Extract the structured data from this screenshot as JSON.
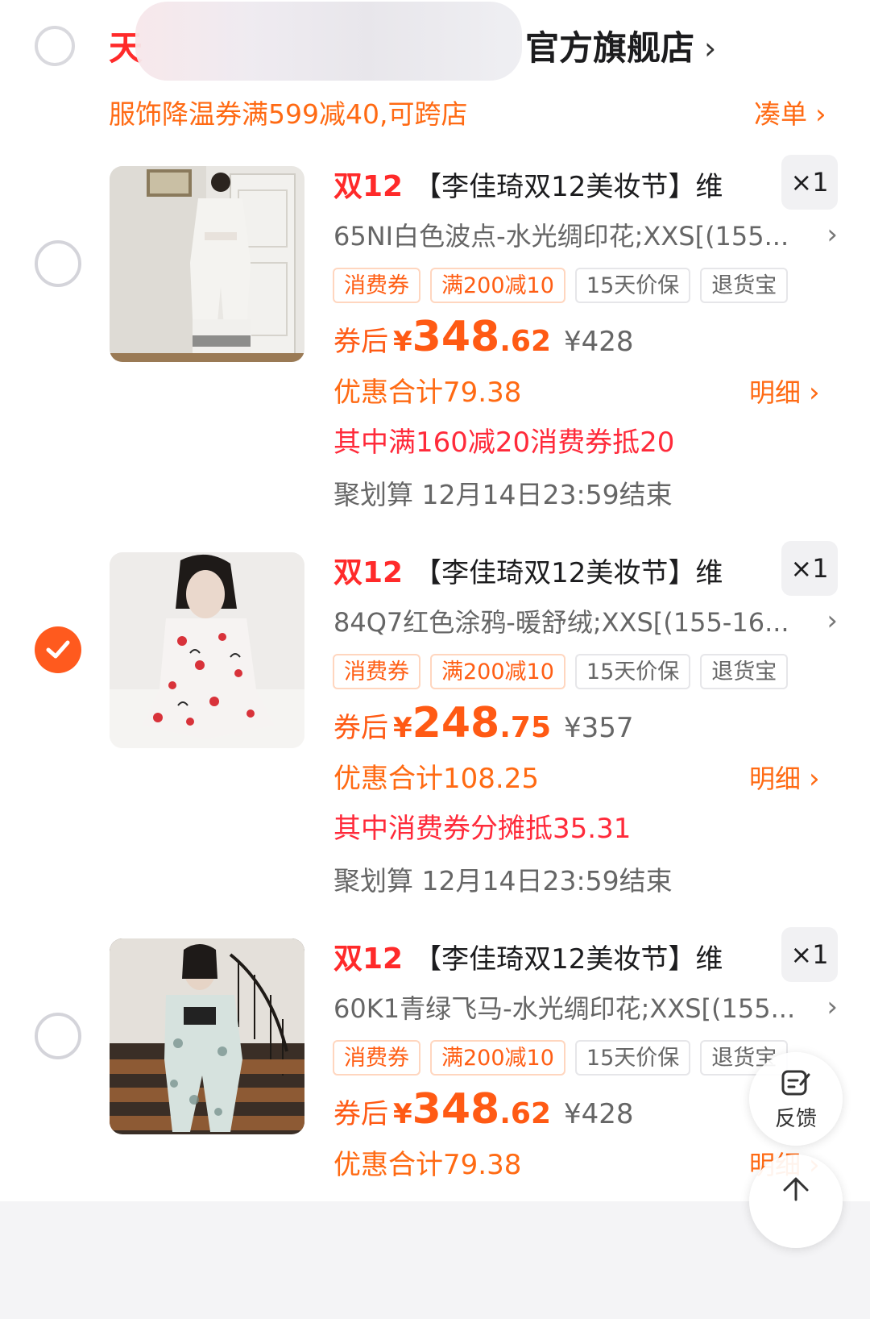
{
  "header": {
    "shop_name_prefix": "天",
    "shop_name_suffix": "官方旗舰店",
    "shop_chevron": "›",
    "promo_text": "服饰降温券满599减40,可跨店",
    "coudan_label": "凑单",
    "coudan_chevron": "›"
  },
  "items": [
    {
      "selected": false,
      "promo_tag": "双12",
      "title": "【李佳琦双12美妆节】维",
      "qty": "×1",
      "sku": "65NI白色波点-水光绸印花;XXS[(155...",
      "sku_chevron": "›",
      "tags": [
        "消费券",
        "满200减10",
        "15天价保",
        "退货宝"
      ],
      "price_label": "券后",
      "price_yen": "¥",
      "price_int": "348",
      "price_dec": ".62",
      "price_orig": "¥428",
      "discount_text": "优惠合计79.38",
      "detail_label": "明细",
      "detail_chevron": "›",
      "coupon_text": "其中满160减20消费券抵20",
      "juhua_text": "聚划算 12月14日23:59结束"
    },
    {
      "selected": true,
      "promo_tag": "双12",
      "title": "【李佳琦双12美妆节】维",
      "qty": "×1",
      "sku": "84Q7红色涂鸦-暖舒绒;XXS[(155-16...",
      "sku_chevron": "›",
      "tags": [
        "消费券",
        "满200减10",
        "15天价保",
        "退货宝"
      ],
      "price_label": "券后",
      "price_yen": "¥",
      "price_int": "248",
      "price_dec": ".75",
      "price_orig": "¥357",
      "discount_text": "优惠合计108.25",
      "detail_label": "明细",
      "detail_chevron": "›",
      "coupon_text": "其中消费券分摊抵35.31",
      "juhua_text": "聚划算 12月14日23:59结束"
    },
    {
      "selected": false,
      "promo_tag": "双12",
      "title": "【李佳琦双12美妆节】维",
      "qty": "×1",
      "sku": "60K1青绿飞马-水光绸印花;XXS[(155...",
      "sku_chevron": "›",
      "tags": [
        "消费券",
        "满200减10",
        "15天价保",
        "退货宝"
      ],
      "price_label": "券后",
      "price_yen": "¥",
      "price_int": "348",
      "price_dec": ".62",
      "price_orig": "¥428",
      "discount_text": "优惠合计79.38",
      "detail_label": "明细",
      "detail_chevron": "›"
    }
  ],
  "floating": {
    "feedback_label": "反馈"
  },
  "colors": {
    "accent_orange": "#ff5a14",
    "accent_red": "#ff2a2a",
    "check_bg": "#ff5a1e"
  }
}
